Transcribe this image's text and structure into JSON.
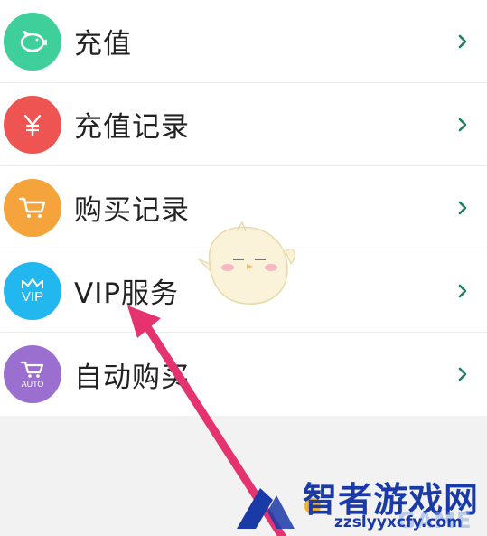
{
  "menu": {
    "items": [
      {
        "label": "充值",
        "icon": "piggy-bank-icon",
        "color": "#3ecf9a"
      },
      {
        "label": "充值记录",
        "icon": "yen-icon",
        "color": "#ee5451"
      },
      {
        "label": "购买记录",
        "icon": "cart-icon",
        "color": "#f4a43b"
      },
      {
        "label": "VIP服务",
        "icon": "vip-crown-icon",
        "color": "#23b7ef",
        "icon_text": "VIP"
      },
      {
        "label": "自动购买",
        "icon": "auto-cart-icon",
        "color": "#9b6fcf",
        "icon_text": "AUTO"
      }
    ],
    "chevron_color": "#1f7f5c"
  },
  "overlay": {
    "arrow_color": "#e5336f",
    "watermark_title": "智者游戏网",
    "watermark_url": "zzslyyxcfy.com",
    "watermark_game": "GAME"
  }
}
